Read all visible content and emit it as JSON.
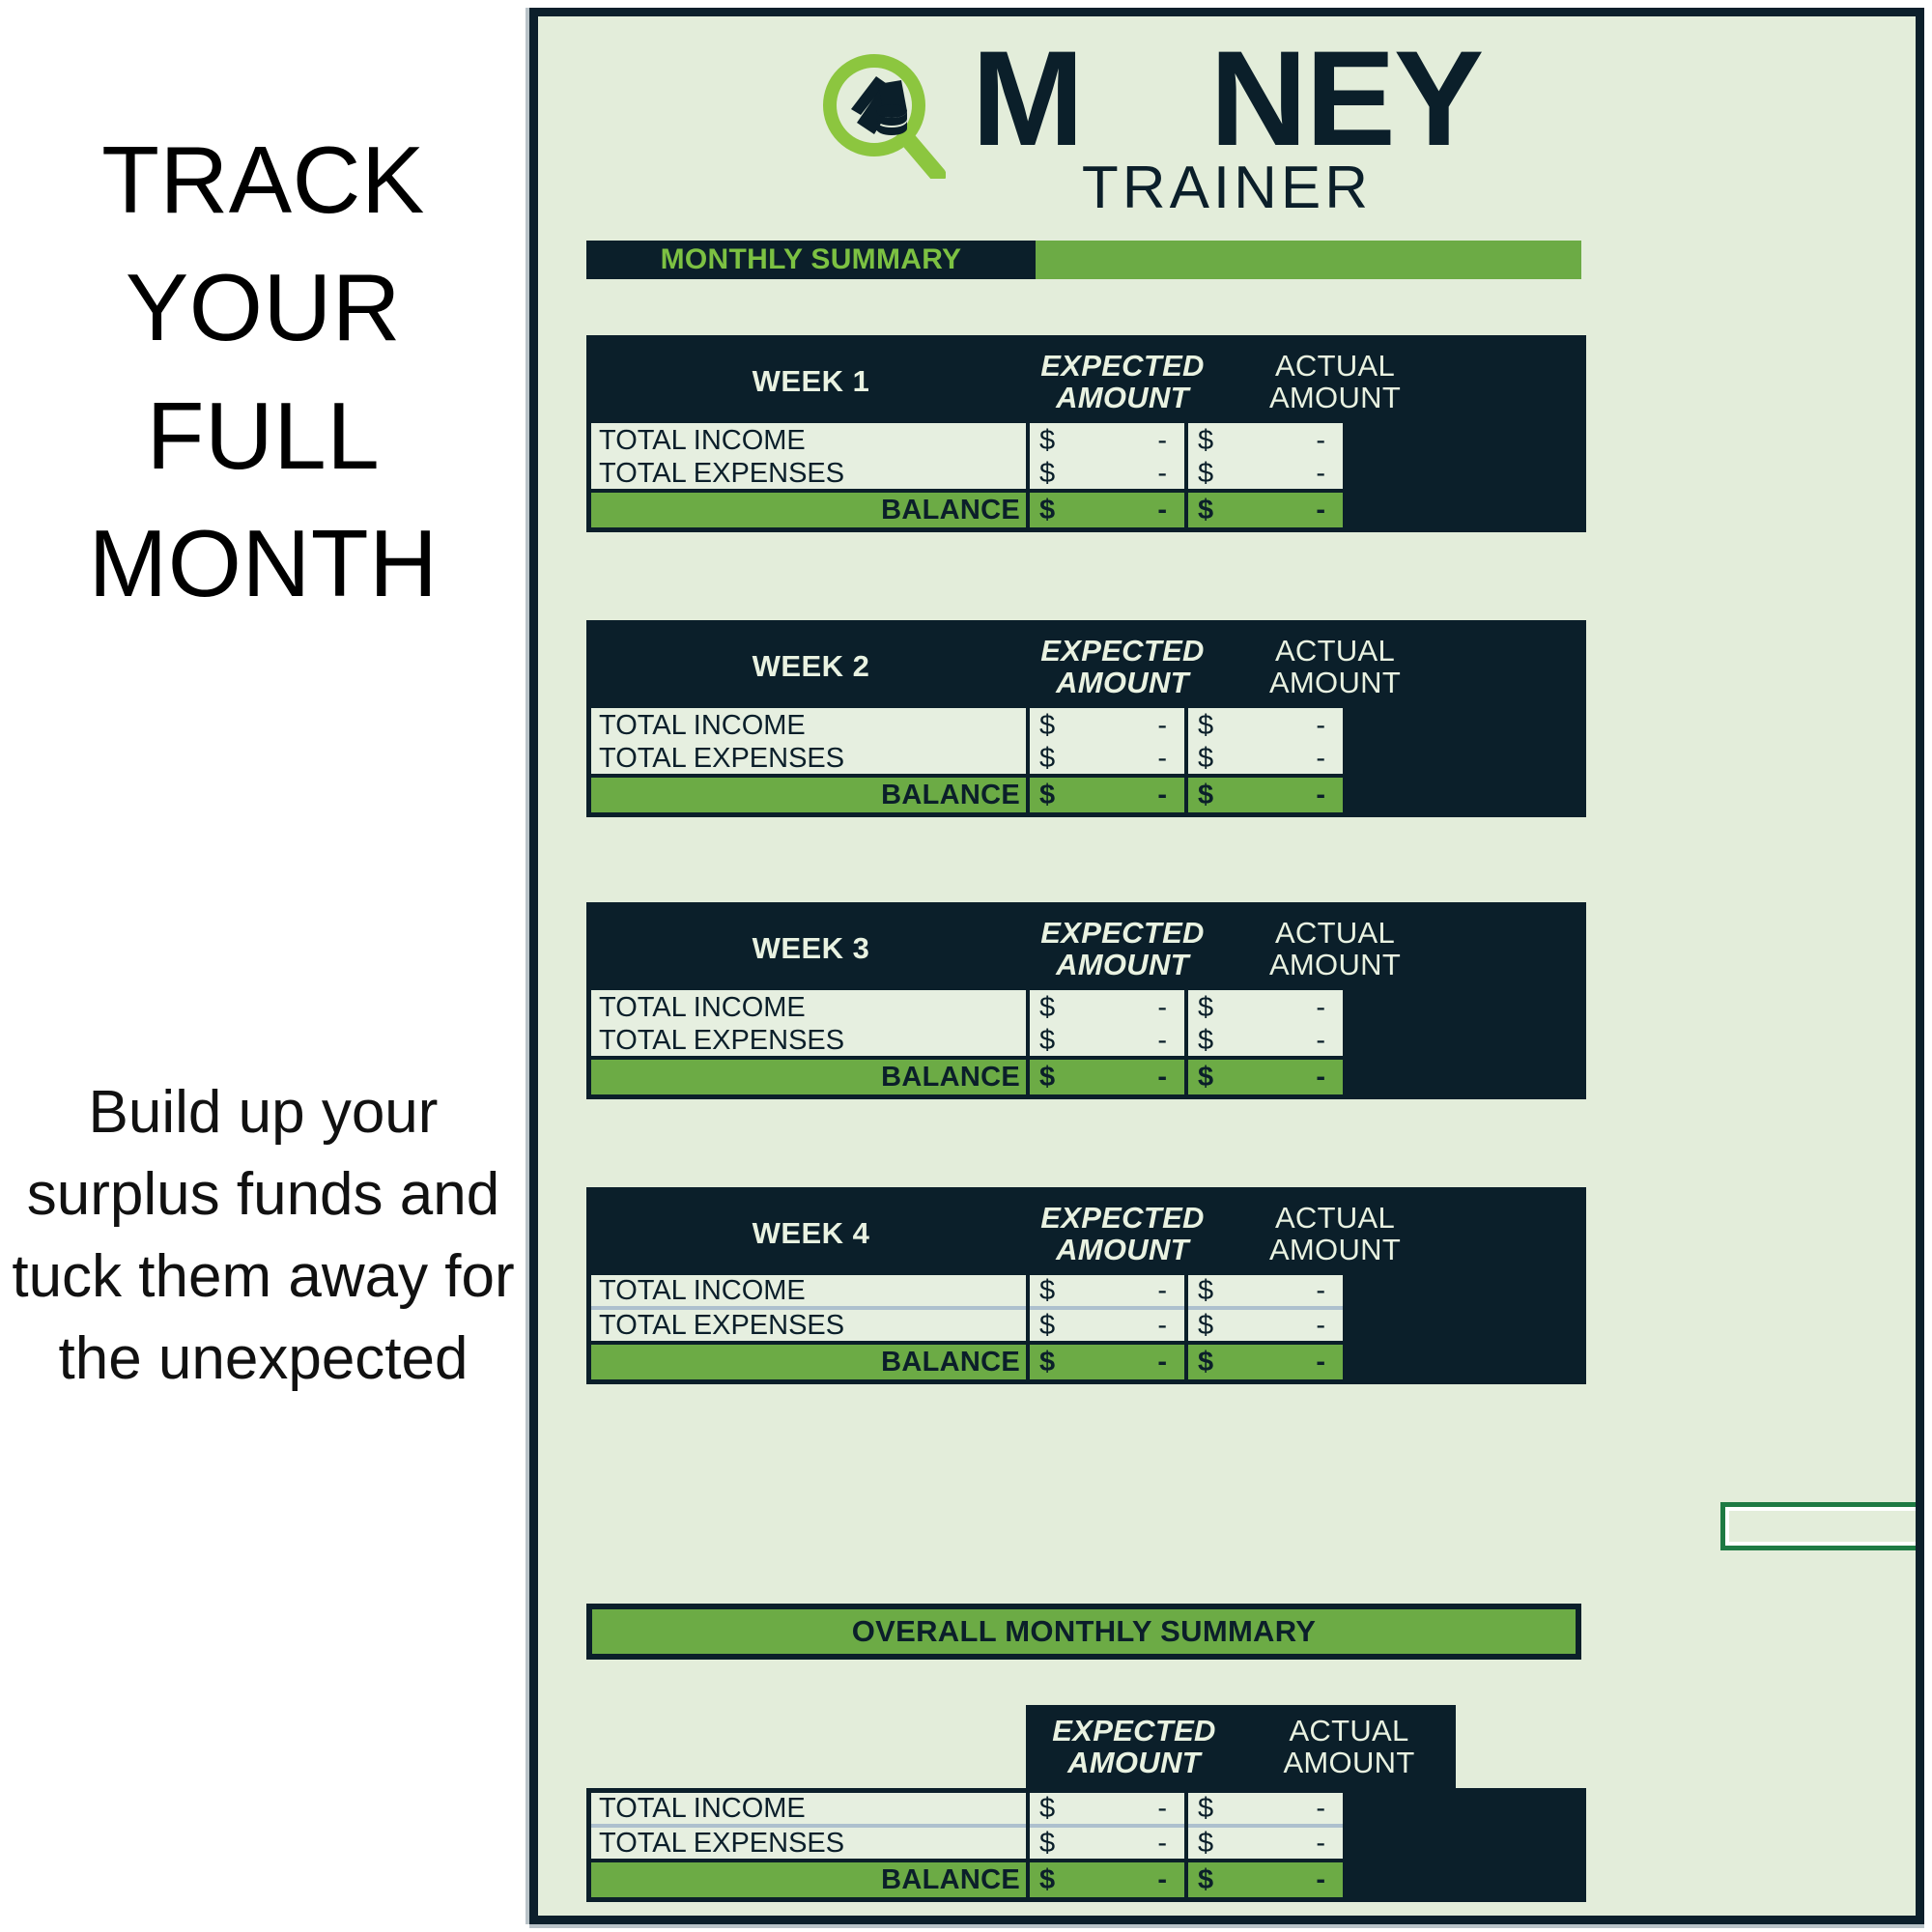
{
  "promo": {
    "headline": "TRACK YOUR FULL MONTH",
    "subcopy": "Build up your surplus funds and tuck them away for the unexpected"
  },
  "logo": {
    "word_left": "M",
    "word_right": "NEY",
    "subtitle": "TRAINER",
    "mark_icon": "magnifier-money-icon",
    "dark_color": "#0b1f2a",
    "green_color": "#8cc63f"
  },
  "sheet": {
    "background": "#e3edda",
    "border_color": "#0b1f2a",
    "accent_green": "#6cab45",
    "bright_green": "#7cc142",
    "monthly_summary_title": "MONTHLY SUMMARY",
    "overall_summary_title": "OVERALL MONTHLY SUMMARY"
  },
  "columns": {
    "expected": [
      "EXPECTED",
      "AMOUNT"
    ],
    "actual": [
      "ACTUAL",
      "AMOUNT"
    ]
  },
  "row_labels": {
    "income": "TOTAL INCOME",
    "expenses": "TOTAL EXPENSES",
    "balance": "BALANCE"
  },
  "currency_symbol": "$",
  "empty_value": "-",
  "weeks": [
    {
      "title": "WEEK 1",
      "rows": [
        {
          "label": "TOTAL INCOME",
          "expected": {
            "sym": "$",
            "val": "-"
          },
          "actual": {
            "sym": "$",
            "val": "-"
          }
        },
        {
          "label": "TOTAL EXPENSES",
          "expected": {
            "sym": "$",
            "val": "-"
          },
          "actual": {
            "sym": "$",
            "val": "-"
          }
        },
        {
          "label": "BALANCE",
          "expected": {
            "sym": "$",
            "val": "-"
          },
          "actual": {
            "sym": "$",
            "val": "-"
          }
        }
      ]
    },
    {
      "title": "WEEK 2",
      "rows": [
        {
          "label": "TOTAL INCOME",
          "expected": {
            "sym": "$",
            "val": "-"
          },
          "actual": {
            "sym": "$",
            "val": "-"
          }
        },
        {
          "label": "TOTAL EXPENSES",
          "expected": {
            "sym": "$",
            "val": "-"
          },
          "actual": {
            "sym": "$",
            "val": "-"
          }
        },
        {
          "label": "BALANCE",
          "expected": {
            "sym": "$",
            "val": "-"
          },
          "actual": {
            "sym": "$",
            "val": "-"
          }
        }
      ]
    },
    {
      "title": "WEEK 3",
      "rows": [
        {
          "label": "TOTAL INCOME",
          "expected": {
            "sym": "$",
            "val": "-"
          },
          "actual": {
            "sym": "$",
            "val": "-"
          }
        },
        {
          "label": "TOTAL EXPENSES",
          "expected": {
            "sym": "$",
            "val": "-"
          },
          "actual": {
            "sym": "$",
            "val": "-"
          }
        },
        {
          "label": "BALANCE",
          "expected": {
            "sym": "$",
            "val": "-"
          },
          "actual": {
            "sym": "$",
            "val": "-"
          }
        }
      ]
    },
    {
      "title": "WEEK 4",
      "rows": [
        {
          "label": "TOTAL INCOME",
          "expected": {
            "sym": "$",
            "val": "-"
          },
          "actual": {
            "sym": "$",
            "val": "-"
          }
        },
        {
          "label": "TOTAL EXPENSES",
          "expected": {
            "sym": "$",
            "val": "-"
          },
          "actual": {
            "sym": "$",
            "val": "-"
          }
        },
        {
          "label": "BALANCE",
          "expected": {
            "sym": "$",
            "val": "-"
          },
          "actual": {
            "sym": "$",
            "val": "-"
          }
        }
      ]
    }
  ],
  "overall": {
    "rows": [
      {
        "label": "TOTAL INCOME",
        "expected": {
          "sym": "$",
          "val": "-"
        },
        "actual": {
          "sym": "$",
          "val": "-"
        }
      },
      {
        "label": "TOTAL EXPENSES",
        "expected": {
          "sym": "$",
          "val": "-"
        },
        "actual": {
          "sym": "$",
          "val": "-"
        }
      },
      {
        "label": "BALANCE",
        "expected": {
          "sym": "$",
          "val": "-"
        },
        "actual": {
          "sym": "$",
          "val": "-"
        }
      }
    ]
  },
  "selection": {
    "name": "active-cell-selection",
    "border_color": "#1e7a43",
    "fill_handle_color": "#2a7b46"
  }
}
